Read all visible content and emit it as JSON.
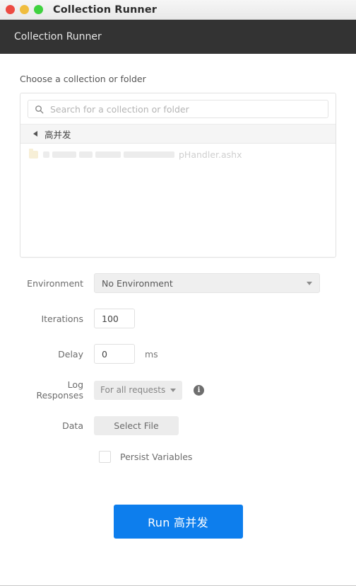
{
  "window": {
    "title": "Collection Runner",
    "traffic_lights": [
      {
        "name": "close",
        "color": "#ed4b43"
      },
      {
        "name": "minimize",
        "color": "#f0bd3e"
      },
      {
        "name": "zoom",
        "color": "#3fd23f"
      }
    ]
  },
  "app_header": {
    "title": "Collection Runner"
  },
  "chooser": {
    "section_label": "Choose a collection or folder",
    "search": {
      "placeholder": "Search for a collection or folder",
      "value": "",
      "icon": "search-icon"
    },
    "breadcrumb": {
      "back_icon": "triangle-left-icon",
      "label": "高并发"
    },
    "items": [
      {
        "icon": "folder-icon",
        "redacted": true,
        "visible_text": "pHandler.ashx"
      }
    ]
  },
  "form": {
    "environment": {
      "label": "Environment",
      "value": "No Environment",
      "chevron": "chevron-down-icon"
    },
    "iterations": {
      "label": "Iterations",
      "value": "100"
    },
    "delay": {
      "label": "Delay",
      "value": "0",
      "unit": "ms"
    },
    "log_responses": {
      "label": "Log Responses",
      "value": "For all requests",
      "chevron": "chevron-down-icon",
      "info_icon": "info-icon",
      "info_glyph": "i"
    },
    "data": {
      "label": "Data",
      "button_label": "Select File"
    },
    "persist_variables": {
      "label": "Persist Variables",
      "checked": false
    }
  },
  "actions": {
    "run_label": "Run 高并发",
    "run_color": "#0d7eed"
  }
}
